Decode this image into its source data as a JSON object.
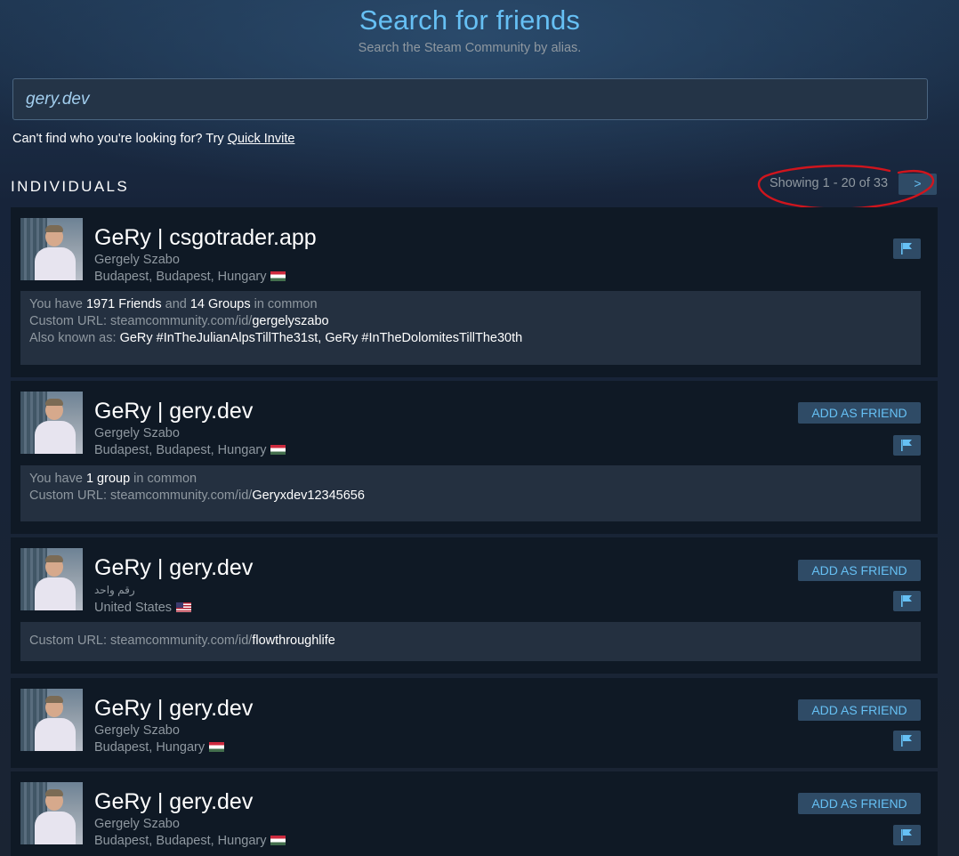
{
  "header": {
    "title": "Search for friends",
    "subtitle": "Search the Steam Community by alias."
  },
  "search": {
    "value": "gery.dev"
  },
  "help": {
    "prefix": "Can't find who you're looking for? Try ",
    "link": "Quick Invite"
  },
  "section": {
    "title": "INDIVIDUALS",
    "paging": "Showing 1 - 20 of 33",
    "next_label": ">"
  },
  "colors": {
    "accent": "#66c0f4",
    "annotation": "#d0151d"
  },
  "results": [
    {
      "persona": "GeRy | csgotrader.app",
      "realname": "Gergely Szabo",
      "location": "Budapest, Budapest, Hungary",
      "flag": "hungary-flag",
      "has_add": false,
      "in_common": {
        "prefix": "You have ",
        "friends": "1971 Friends",
        "and": " and ",
        "groups": "14 Groups",
        "suffix": " in common"
      },
      "custom_url": {
        "prefix": "Custom URL: steamcommunity.com/id/",
        "id": "gergelyszabo"
      },
      "aka": {
        "prefix": "Also known as: ",
        "names": "GeRy #InTheJulianAlpsTillThe31st, GeRy #InTheDolomitesTillThe30th"
      }
    },
    {
      "persona": "GeRy | gery.dev",
      "realname": "Gergely Szabo",
      "location": "Budapest, Budapest, Hungary",
      "flag": "hungary-flag",
      "has_add": true,
      "add_label": "ADD AS FRIEND",
      "in_common": {
        "prefix": "You have ",
        "groups": "1 group",
        "suffix": " in common"
      },
      "custom_url": {
        "prefix": "Custom URL: steamcommunity.com/id/",
        "id": "Geryxdev12345656"
      }
    },
    {
      "persona": "GeRy | gery.dev",
      "realname": "رقم واحد",
      "location": "United States",
      "flag": "usa-flag",
      "has_add": true,
      "add_label": "ADD AS FRIEND",
      "custom_url": {
        "prefix": "Custom URL: steamcommunity.com/id/",
        "id": "flowthroughlife"
      }
    },
    {
      "persona": "GeRy | gery.dev",
      "realname": "Gergely Szabo",
      "location": "Budapest, Hungary",
      "flag": "hungary-flag",
      "has_add": true,
      "add_label": "ADD AS FRIEND"
    },
    {
      "persona": "GeRy | gery.dev",
      "realname": "Gergely Szabo",
      "location": "Budapest, Budapest, Hungary",
      "flag": "hungary-flag",
      "has_add": true,
      "add_label": "ADD AS FRIEND"
    }
  ]
}
